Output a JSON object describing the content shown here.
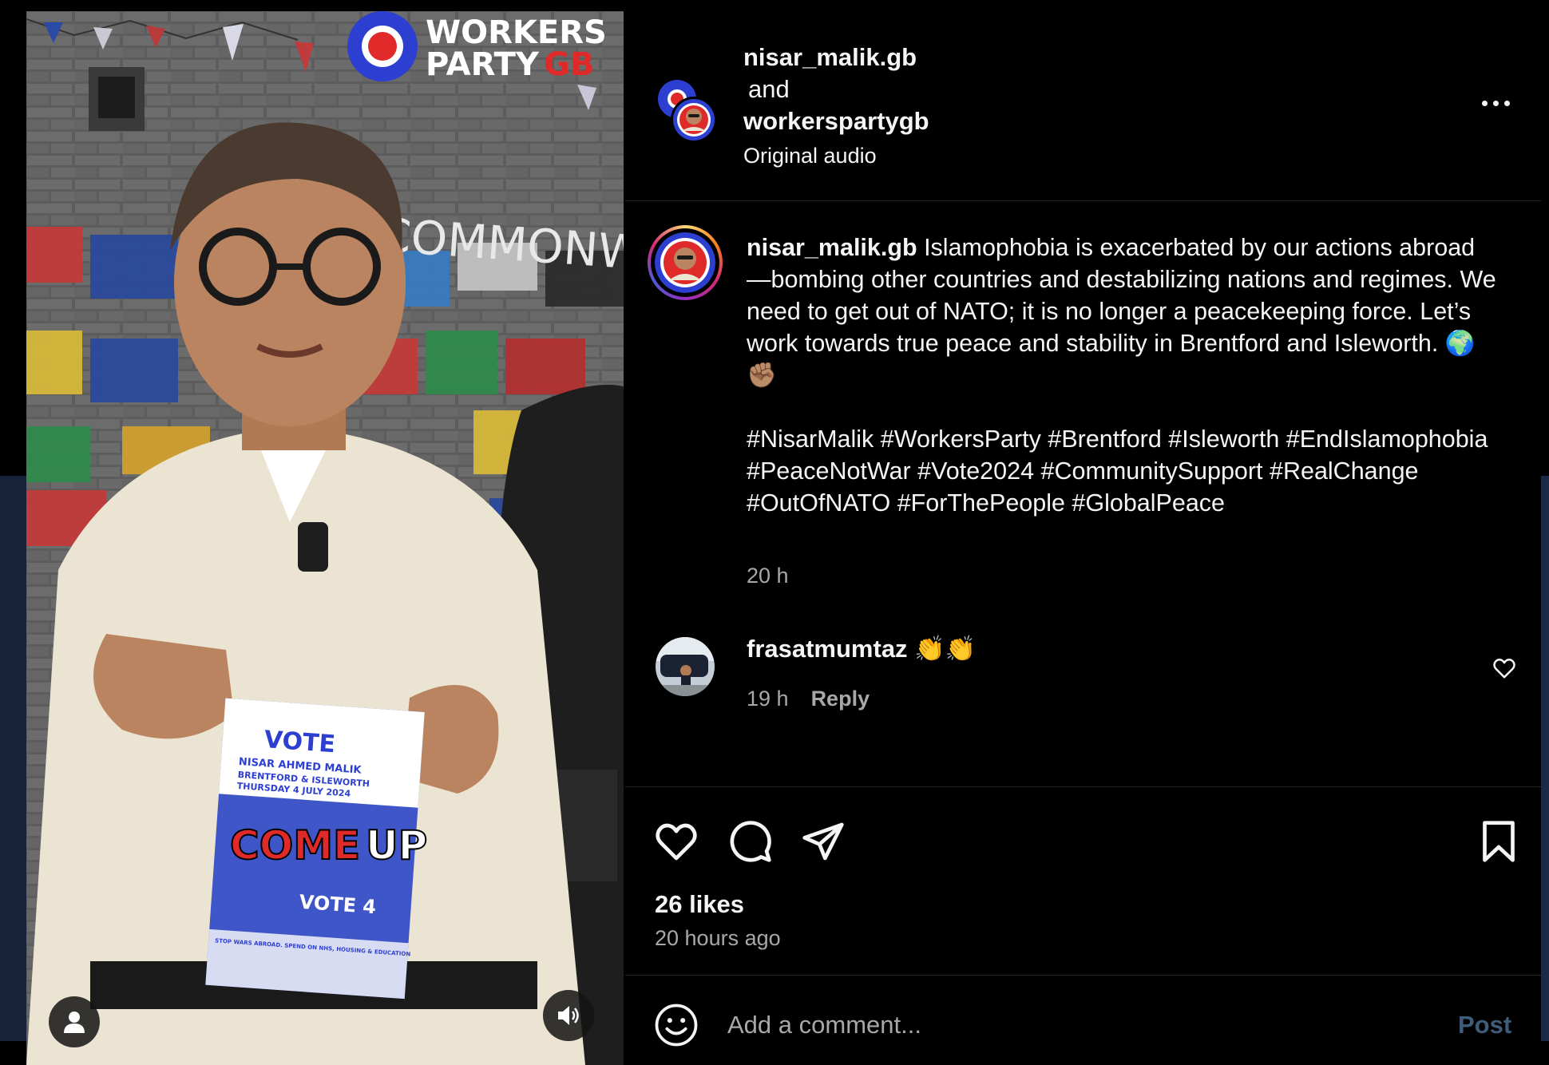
{
  "post_header": {
    "author": "nisar_malik.gb",
    "conjunction": "and",
    "collaborator": "workerspartygb",
    "audio": "Original audio",
    "more_icon": "more-horizontal-icon"
  },
  "caption": {
    "username": "nisar_malik.gb",
    "text": "Islamophobia is exacerbated by our actions abroad—bombing other countries and destabilizing nations and regimes. We need to get out of NATO; it is no longer a peacekeeping force. Let’s work towards true peace and stability in Brentford and Isleworth. 🌍✊🏽",
    "hashtags": "#NisarMalik #WorkersParty #Brentford #Isleworth #EndIslamophobia #PeaceNotWar #Vote2024 #CommunitySupport #RealChange #OutOfNATO #ForThePeople #GlobalPeace",
    "time": "20 h"
  },
  "comments": [
    {
      "username": "frasatmumtaz",
      "text": "👏👏",
      "time": "19 h",
      "reply_label": "Reply"
    }
  ],
  "actions": {
    "icons": [
      "heart-icon",
      "comment-icon",
      "share-icon",
      "bookmark-icon"
    ],
    "likes": "26 likes",
    "posted": "20 hours ago"
  },
  "add_comment": {
    "placeholder": "Add a comment...",
    "post_label": "Post",
    "emoji_icon": "emoji-icon"
  },
  "media": {
    "brand_line1": "WORKERS",
    "brand_line2a": "PARTY",
    "brand_line2b": "GB",
    "wall_text": "COMMONWEALTH",
    "subtitle_a": "COME",
    "subtitle_b": "UP",
    "leaflet_heading": "VOTE",
    "leaflet_name": "NISAR AHMED MALIK",
    "leaflet_constituency": "BRENTFORD & ISLEWORTH",
    "leaflet_date": "THURSDAY 4 JULY 2024",
    "leaflet_vote": "VOTE 4",
    "leaflet_footer": "STOP WARS ABROAD. SPEND ON NHS, HOUSING & EDUCATION",
    "controls": [
      "user-icon",
      "volume-icon"
    ]
  },
  "colors": {
    "background": "#000000",
    "text_primary": "#f5f5f5",
    "text_secondary": "#a8a8a8",
    "divider": "#262626",
    "post_button_disabled": "#3f5d79",
    "brand_red": "#e02a2a",
    "brand_blue": "#2d3fd1"
  }
}
